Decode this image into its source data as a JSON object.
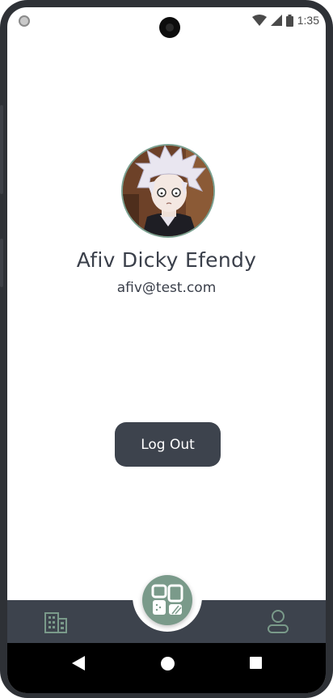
{
  "status_bar": {
    "time": "1:35"
  },
  "profile": {
    "name": "Afiv Dicky Efendy",
    "email": "afiv@test.com",
    "avatar_icon": "anime-character-avatar"
  },
  "actions": {
    "logout_label": "Log Out"
  },
  "bottom_nav": {
    "left_icon": "building-icon",
    "center_icon": "dashboard-grid-icon",
    "right_icon": "profile-icon"
  },
  "system_nav": {
    "back_icon": "back-triangle-icon",
    "home_icon": "home-circle-icon",
    "recents_icon": "recents-square-icon"
  },
  "colors": {
    "accent": "#7a9a8a",
    "dark": "#3d434d",
    "text": "#3a3f4a",
    "background": "#ffffff"
  }
}
